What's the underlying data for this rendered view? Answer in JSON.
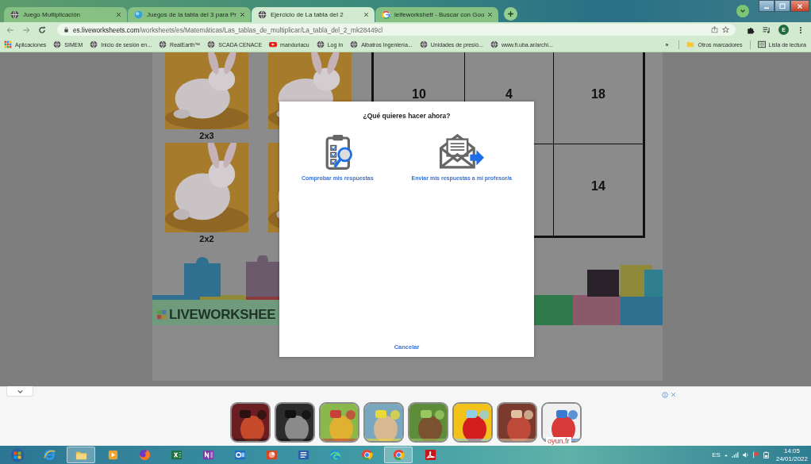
{
  "tabs": [
    {
      "title": "Juego Multiplicación",
      "kind": "globe",
      "selected": false
    },
    {
      "title": "Juegos de la tabla del 3 para Pr",
      "kind": "sphere",
      "selected": false
    },
    {
      "title": "Ejercicio de La tabla del 2",
      "kind": "globe",
      "selected": true
    },
    {
      "title": "leifeworkshett - Buscar con Goo",
      "kind": "search",
      "selected": false
    }
  ],
  "address": {
    "host": "es.liveworksheets.com",
    "path": "/worksheets/es/Matemáticas/Las_tablas_de_multiplicar/La_tabla_del_2_mk28449cl"
  },
  "profile_initial": "E",
  "bookmarks": [
    {
      "label": "Aplicaciones",
      "kind": "apps"
    },
    {
      "label": "SIMEM",
      "kind": "globe"
    },
    {
      "label": "Inicio de sesión en...",
      "kind": "globe"
    },
    {
      "label": "RealEarth™",
      "kind": "globe"
    },
    {
      "label": "SCADA CENACE",
      "kind": "globe"
    },
    {
      "label": "manduriacu",
      "kind": "video"
    },
    {
      "label": "Log In",
      "kind": "globe"
    },
    {
      "label": "Albatros Ingeniería...",
      "kind": "globe"
    },
    {
      "label": "Unidades de presió...",
      "kind": "globe"
    },
    {
      "label": "www.fi.uba.ar/archi...",
      "kind": "globe"
    }
  ],
  "bookmarks_overflow": "»",
  "other_bookmarks": "Otros marcadores",
  "reading_list": "Lista de lectura",
  "worksheet": {
    "tile_labels": [
      "2x3",
      "2x2"
    ],
    "table_rows": [
      [
        "10",
        "4",
        "18"
      ],
      [
        "14"
      ]
    ],
    "logo": "LIVEWORKSHEE"
  },
  "dialog": {
    "title": "¿Qué quieres hacer ahora?",
    "options": [
      {
        "label": "Comprobar mis respuestas",
        "kind": "check"
      },
      {
        "label": "Enviar mis respuestas a mi profesor/a",
        "kind": "send"
      }
    ],
    "cancel": "Cancelar"
  },
  "ad": {
    "brand": "oyun.fr"
  },
  "taskbar": {
    "apps": [
      {
        "kind": "start",
        "selected": false
      },
      {
        "kind": "swirl",
        "selected": false
      },
      {
        "kind": "folder",
        "selected": true
      },
      {
        "kind": "media",
        "selected": false
      },
      {
        "kind": "flame",
        "selected": false
      },
      {
        "kind": "sheet",
        "selected": false
      },
      {
        "kind": "notes",
        "selected": false
      },
      {
        "kind": "mail",
        "selected": false
      },
      {
        "kind": "slides",
        "selected": false
      },
      {
        "kind": "doc",
        "selected": false
      },
      {
        "kind": "wave",
        "selected": false
      },
      {
        "kind": "ring",
        "selected": false
      },
      {
        "kind": "ring",
        "selected": true
      },
      {
        "kind": "curl",
        "selected": false
      }
    ],
    "language": "ES",
    "time": "14:05",
    "date": "24/01/2022"
  }
}
